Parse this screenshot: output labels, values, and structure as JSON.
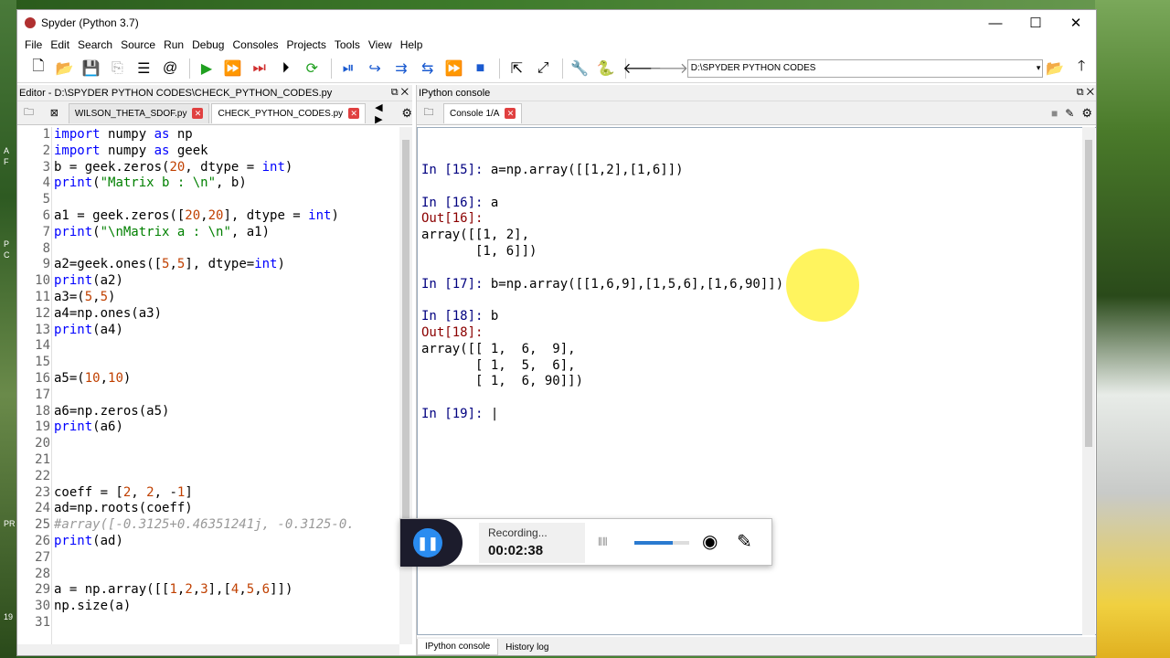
{
  "window": {
    "title": "Spyder (Python 3.7)",
    "minimize": "—",
    "maximize": "☐",
    "close": "✕"
  },
  "menu": [
    "File",
    "Edit",
    "Search",
    "Source",
    "Run",
    "Debug",
    "Consoles",
    "Projects",
    "Tools",
    "View",
    "Help"
  ],
  "toolbar": {
    "path": "D:\\SPYDER PYTHON CODES"
  },
  "editor": {
    "title": "Editor - D:\\SPYDER PYTHON CODES\\CHECK_PYTHON_CODES.py",
    "tabs": [
      "WILSON_THETA_SDOF.py",
      "CHECK_PYTHON_CODES.py"
    ],
    "lines": [
      {
        "n": "1",
        "t": "import numpy as np"
      },
      {
        "n": "2",
        "t": "import numpy as geek"
      },
      {
        "n": "3",
        "t": "b = geek.zeros(20, dtype = int)"
      },
      {
        "n": "4",
        "t": "print(\"Matrix b : \\n\", b)"
      },
      {
        "n": "5",
        "t": ""
      },
      {
        "n": "6",
        "t": "a1 = geek.zeros([20,20], dtype = int)"
      },
      {
        "n": "7",
        "t": "print(\"\\nMatrix a : \\n\", a1)"
      },
      {
        "n": "8",
        "t": ""
      },
      {
        "n": "9",
        "t": "a2=geek.ones([5,5], dtype=int)"
      },
      {
        "n": "10",
        "t": "print(a2)"
      },
      {
        "n": "11",
        "t": "a3=(5,5)"
      },
      {
        "n": "12",
        "t": "a4=np.ones(a3)"
      },
      {
        "n": "13",
        "t": "print(a4)"
      },
      {
        "n": "14",
        "t": ""
      },
      {
        "n": "15",
        "t": ""
      },
      {
        "n": "16",
        "t": "a5=(10,10)"
      },
      {
        "n": "17",
        "t": ""
      },
      {
        "n": "18",
        "t": "a6=np.zeros(a5)"
      },
      {
        "n": "19",
        "t": "print(a6)"
      },
      {
        "n": "20",
        "t": ""
      },
      {
        "n": "21",
        "t": ""
      },
      {
        "n": "22",
        "t": ""
      },
      {
        "n": "23",
        "t": "coeff = [2, 2, -1]"
      },
      {
        "n": "24",
        "t": "ad=np.roots(coeff)"
      },
      {
        "n": "25",
        "t": "#array([-0.3125+0.46351241j, -0.3125-0."
      },
      {
        "n": "26",
        "t": "print(ad)"
      },
      {
        "n": "27",
        "t": ""
      },
      {
        "n": "28",
        "t": ""
      },
      {
        "n": "29",
        "t": "a = np.array([[1,2,3],[4,5,6]])"
      },
      {
        "n": "30",
        "t": "np.size(a)"
      },
      {
        "n": "31",
        "t": ""
      }
    ]
  },
  "console": {
    "title": "IPython console",
    "tab": "Console 1/A",
    "lines": [
      {
        "k": "in",
        "p": "In [15]: ",
        "t": "a=np.array([[1,2],[1,6]])"
      },
      {
        "k": "blank",
        "p": "",
        "t": ""
      },
      {
        "k": "in",
        "p": "In [16]: ",
        "t": "a"
      },
      {
        "k": "out",
        "p": "Out[16]:",
        "t": ""
      },
      {
        "k": "text",
        "p": "",
        "t": "array([[1, 2],"
      },
      {
        "k": "text",
        "p": "",
        "t": "       [1, 6]])"
      },
      {
        "k": "blank",
        "p": "",
        "t": ""
      },
      {
        "k": "in",
        "p": "In [17]: ",
        "t": "b=np.array([[1,6,9],[1,5,6],[1,6,90]])"
      },
      {
        "k": "blank",
        "p": "",
        "t": ""
      },
      {
        "k": "in",
        "p": "In [18]: ",
        "t": "b"
      },
      {
        "k": "out",
        "p": "Out[18]:",
        "t": ""
      },
      {
        "k": "text",
        "p": "",
        "t": "array([[ 1,  6,  9],"
      },
      {
        "k": "text",
        "p": "",
        "t": "       [ 1,  5,  6],"
      },
      {
        "k": "text",
        "p": "",
        "t": "       [ 1,  6, 90]])"
      },
      {
        "k": "blank",
        "p": "",
        "t": ""
      },
      {
        "k": "in",
        "p": "In [19]: ",
        "t": "|"
      }
    ],
    "bottom_tabs": [
      "IPython console",
      "History log"
    ]
  },
  "recording": {
    "status": "Recording...",
    "time": "00:02:38",
    "volume": 0.7
  }
}
